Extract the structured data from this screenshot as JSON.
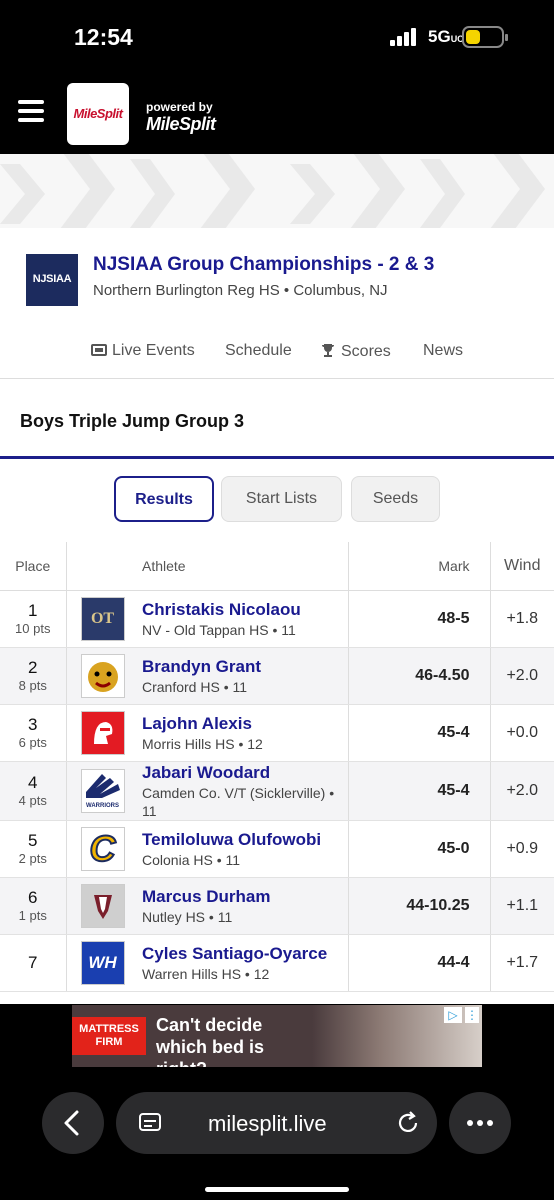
{
  "status_bar": {
    "time": "12:54",
    "network": "5G",
    "network_suffix": "UC"
  },
  "brand": {
    "logo": "MileSplit",
    "powered_by": "powered by",
    "powered_logo": "MileSplit"
  },
  "meet": {
    "logo_text": "NJSIAA",
    "title": "NJSIAA Group Championships - 2 & 3",
    "subtitle": "Northern Burlington Reg HS • Columbus, NJ"
  },
  "subnav": {
    "live": "Live Events",
    "schedule": "Schedule",
    "scores": "Scores",
    "news": "News"
  },
  "event_title": "Boys Triple Jump Group 3",
  "tabs": {
    "results": "Results",
    "start_lists": "Start Lists",
    "seeds": "Seeds"
  },
  "table": {
    "headers": {
      "place": "Place",
      "athlete": "Athlete",
      "mark": "Mark",
      "wind": "Wind"
    },
    "rows": [
      {
        "place": "1",
        "pts": "10 pts",
        "name": "Christakis Nicolaou",
        "school": "NV - Old Tappan HS • 11",
        "mark": "48-5",
        "wind": "+1.8",
        "logo_text": "OT"
      },
      {
        "place": "2",
        "pts": "8 pts",
        "name": "Brandyn Grant",
        "school": "Cranford HS • 11",
        "mark": "46-4.50",
        "wind": "+2.0",
        "logo_text": ""
      },
      {
        "place": "3",
        "pts": "6 pts",
        "name": "Lajohn Alexis",
        "school": "Morris Hills HS • 12",
        "mark": "45-4",
        "wind": "+0.0",
        "logo_text": ""
      },
      {
        "place": "4",
        "pts": "4 pts",
        "name": "Jabari Woodard",
        "school": "Camden Co. V/T (Sicklerville) • 11",
        "mark": "45-4",
        "wind": "+2.0",
        "logo_text": "WARRIORS"
      },
      {
        "place": "5",
        "pts": "2 pts",
        "name": "Temiloluwa Olufowobi",
        "school": "Colonia HS • 11",
        "mark": "45-0",
        "wind": "+0.9",
        "logo_text": "C"
      },
      {
        "place": "6",
        "pts": "1 pts",
        "name": "Marcus Durham",
        "school": "Nutley HS • 11",
        "mark": "44-10.25",
        "wind": "+1.1",
        "logo_text": ""
      },
      {
        "place": "7",
        "pts": "",
        "name": "Cyles Santiago-Oyarce",
        "school": "Warren Hills HS • 12",
        "mark": "44-4",
        "wind": "+1.7",
        "logo_text": "WH"
      }
    ]
  },
  "ad": {
    "brand": "MATTRESS FIRM",
    "text": "Can't decide which bed is right?"
  },
  "browser": {
    "url": "milesplit.live"
  },
  "colors": {
    "navy": "#1a1a8f",
    "accent": "#1c1f8a",
    "brand_red": "#c8102e"
  }
}
